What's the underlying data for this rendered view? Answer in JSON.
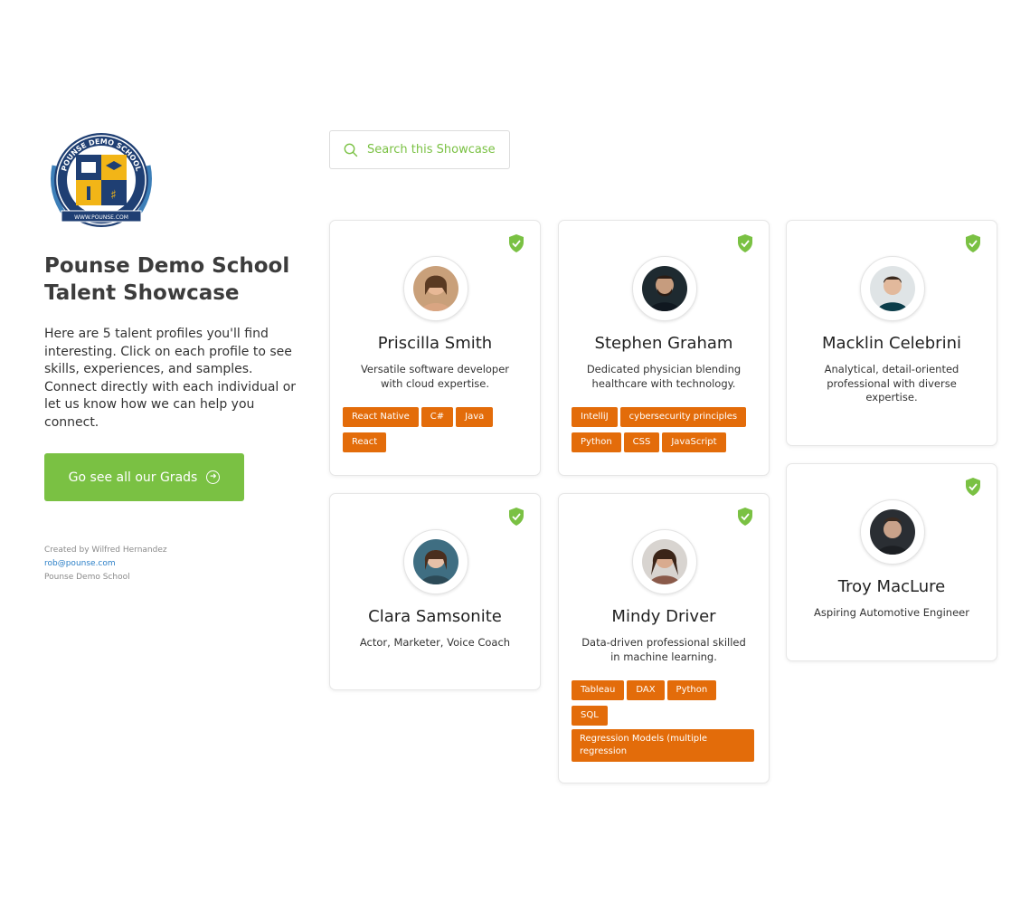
{
  "school": {
    "title": "Pounse Demo School Talent Showcase",
    "intro": "Here are 5 talent profiles you'll find interesting. Click on each profile to see skills, experiences, and samples. Connect directly with each individual or let us know how we can help you connect.",
    "cta_label": "Go see all our Grads",
    "logo_text": "POUNSE DEMO SCHOOL",
    "logo_url_text": "WWW.POUNSE.COM"
  },
  "footer": {
    "created_by": "Created by Wilfred Hernandez",
    "email": "rob@pounse.com",
    "org": "Pounse Demo School"
  },
  "search": {
    "placeholder": "Search this Showcase",
    "icon": "search-icon"
  },
  "colors": {
    "accent": "#7ac143",
    "tag": "#e36c0a",
    "link": "#2b7fc7"
  },
  "profiles": [
    {
      "name": "Priscilla Smith",
      "bio": "Versatile software developer with cloud expertise.",
      "tags": [
        "React Native",
        "C#",
        "Java",
        "React"
      ]
    },
    {
      "name": "Stephen Graham",
      "bio": "Dedicated physician blending healthcare with technology.",
      "tags": [
        "IntelliJ",
        "cybersecurity principles",
        "Python",
        "CSS",
        "JavaScript"
      ]
    },
    {
      "name": "Macklin Celebrini",
      "bio": "Analytical, detail-oriented professional with diverse expertise.",
      "tags": []
    },
    {
      "name": "Clara Samsonite",
      "bio": "Actor, Marketer, Voice Coach",
      "tags": []
    },
    {
      "name": "Mindy Driver",
      "bio": "Data-driven professional skilled in machine learning.",
      "tags": [
        "Tableau",
        "DAX",
        "Python",
        "SQL",
        "Regression Models (multiple regression"
      ]
    },
    {
      "name": "Troy MacLure",
      "bio": "Aspiring Automotive Engineer",
      "tags": []
    }
  ]
}
